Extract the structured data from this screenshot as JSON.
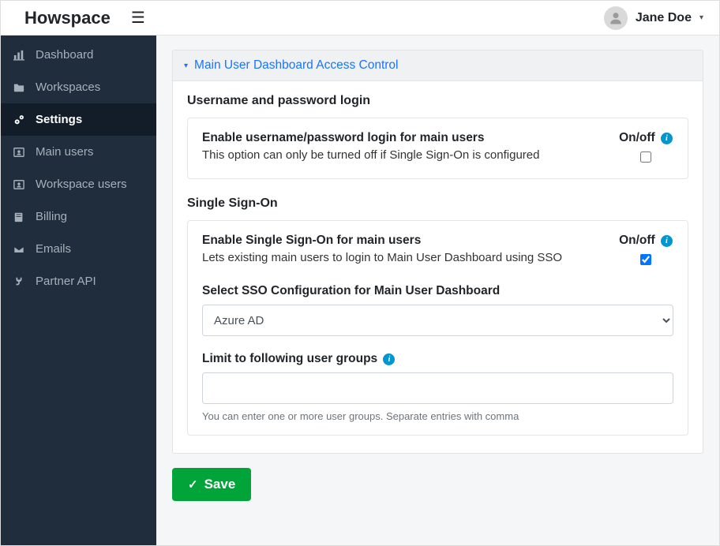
{
  "brand": "Howspace",
  "user": {
    "name": "Jane Doe"
  },
  "sidebar": {
    "items": [
      {
        "label": "Dashboard"
      },
      {
        "label": "Workspaces"
      },
      {
        "label": "Settings"
      },
      {
        "label": "Main users"
      },
      {
        "label": "Workspace users"
      },
      {
        "label": "Billing"
      },
      {
        "label": "Emails"
      },
      {
        "label": "Partner API"
      }
    ]
  },
  "panel": {
    "title": "Main User Dashboard Access Control",
    "upw": {
      "heading": "Username and password login",
      "label": "Enable username/password login for main users",
      "desc": "This option can only be turned off if Single Sign-On is configured",
      "onoff": "On/off"
    },
    "sso": {
      "heading": "Single Sign-On",
      "label": "Enable Single Sign-On for main users",
      "desc": "Lets existing main users to login to Main User Dashboard using SSO",
      "onoff": "On/off",
      "config_label": "Select SSO Configuration for Main User Dashboard",
      "config_selected": "Azure AD",
      "limit_label": "Limit to following user groups",
      "limit_hint": "You can enter one or more user groups. Separate entries with comma"
    },
    "save_label": "Save"
  }
}
